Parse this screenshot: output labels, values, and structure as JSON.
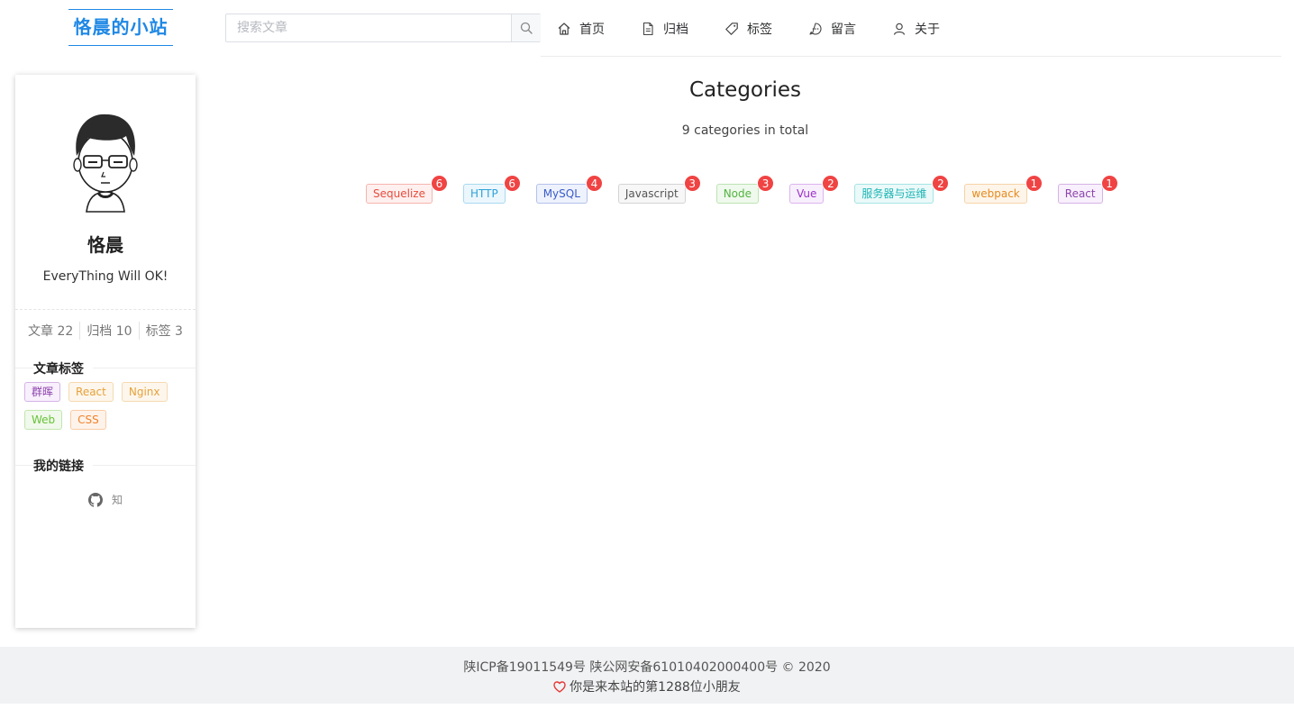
{
  "header": {
    "site_title": "恪晨的小站",
    "search": {
      "placeholder": "搜索文章",
      "value": "",
      "icon": "search-icon"
    },
    "nav": [
      {
        "label": "首页",
        "icon": "home-icon"
      },
      {
        "label": "归档",
        "icon": "document-icon"
      },
      {
        "label": "标签",
        "icon": "tag-icon"
      },
      {
        "label": "留言",
        "icon": "chat-bubble-icon"
      },
      {
        "label": "关于",
        "icon": "user-icon"
      }
    ]
  },
  "sidebar": {
    "author_name": "恪晨",
    "motto": "EveryThing Will OK!",
    "stats": [
      {
        "label": "文章",
        "value": "22"
      },
      {
        "label": "归档",
        "value": "10"
      },
      {
        "label": "标签",
        "value": "3"
      }
    ],
    "tags_title": "文章标签",
    "tags": [
      {
        "label": "群晖",
        "color": "#8e44ad"
      },
      {
        "label": "React",
        "color": "#e6a23c"
      },
      {
        "label": "Nginx",
        "color": "#e6a23c"
      },
      {
        "label": "Web",
        "color": "#67c23a"
      },
      {
        "label": "CSS",
        "color": "#f0822b"
      }
    ],
    "links_title": "我的链接",
    "links": [
      {
        "icon": "github-icon"
      },
      {
        "label": "知"
      }
    ]
  },
  "main": {
    "title": "Categories",
    "subtitle": "9 categories in total",
    "categories": [
      {
        "name": "Sequelize",
        "count": "6",
        "color": "#e74c3c"
      },
      {
        "name": "HTTP",
        "count": "6",
        "color": "#2fa2d8"
      },
      {
        "name": "MySQL",
        "count": "4",
        "color": "#3a5cc8"
      },
      {
        "name": "Javascript",
        "count": "3",
        "color": "#555555"
      },
      {
        "name": "Node",
        "count": "3",
        "color": "#52b441"
      },
      {
        "name": "Vue",
        "count": "2",
        "color": "#9b30c9"
      },
      {
        "name": "服务器与运维",
        "count": "2",
        "color": "#1fb5b5"
      },
      {
        "name": "webpack",
        "count": "1",
        "color": "#e68a1e"
      },
      {
        "name": "React",
        "count": "1",
        "color": "#8e44ad"
      }
    ],
    "badge_color": "#f04343"
  },
  "footer": {
    "line1": "陕ICP备19011549号 陕公网安备61010402000400号 © 2020",
    "line2": "你是来本站的第1288位小朋友",
    "heart_icon": "heart-icon",
    "accent": "#e53935"
  },
  "colors": {
    "brand": "#1e88e5"
  }
}
